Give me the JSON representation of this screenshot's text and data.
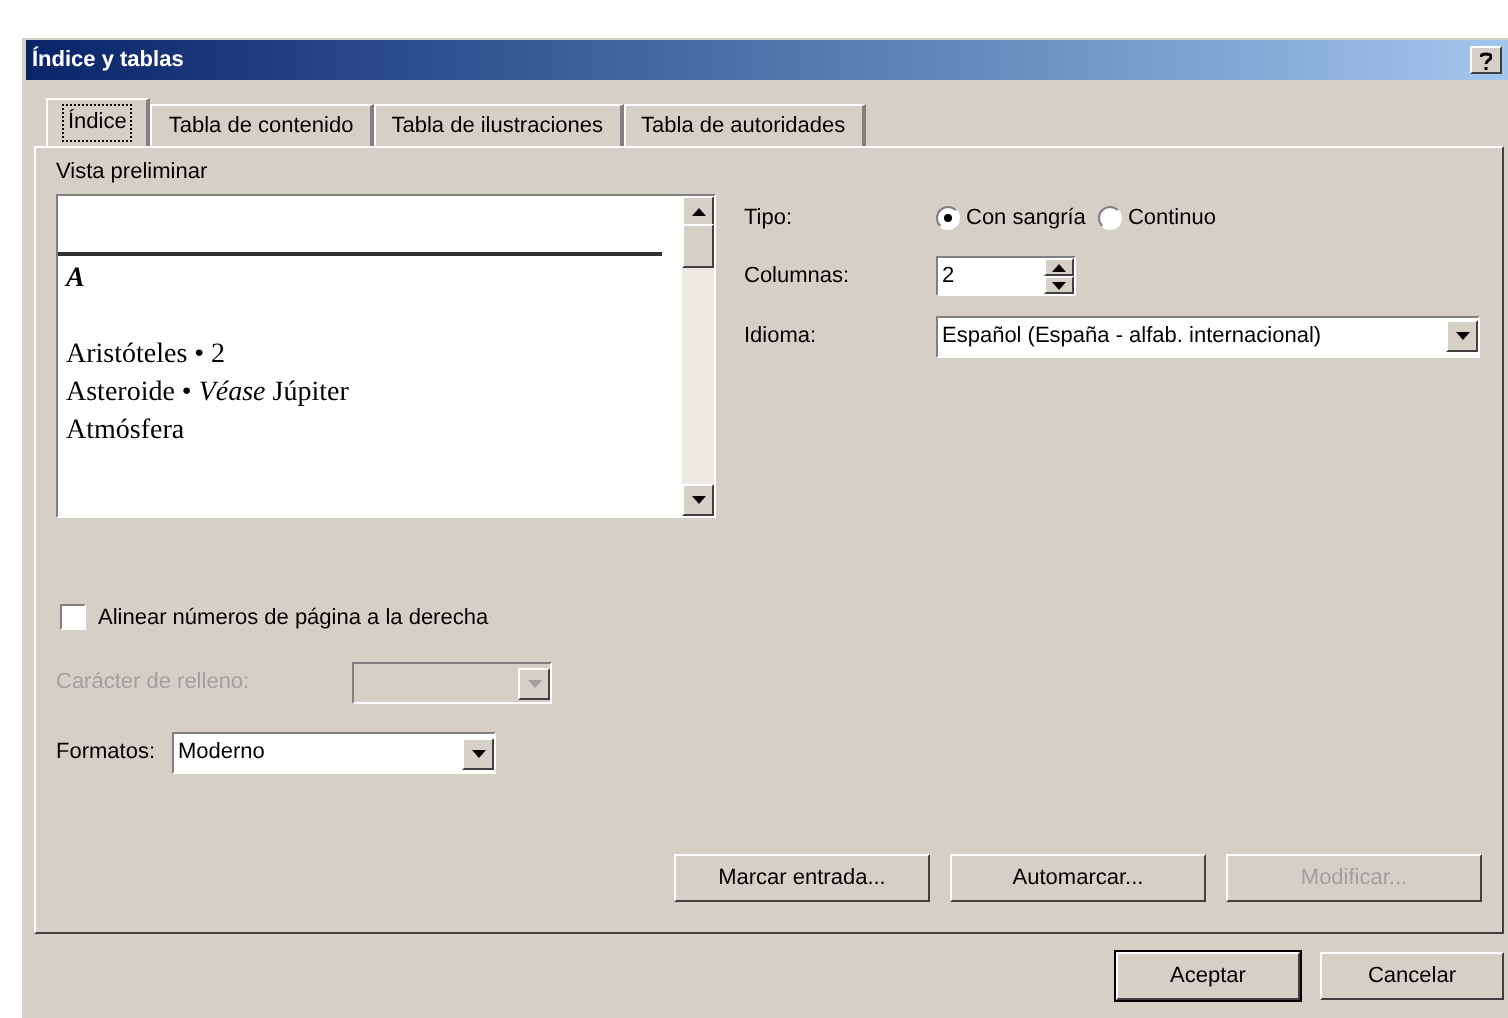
{
  "window": {
    "title": "Índice y tablas"
  },
  "tabs": [
    {
      "label": "Índice",
      "selected": true
    },
    {
      "label": "Tabla de contenido",
      "selected": false
    },
    {
      "label": "Tabla de ilustraciones",
      "selected": false
    },
    {
      "label": "Tabla de autoridades",
      "selected": false
    }
  ],
  "preview": {
    "label": "Vista preliminar",
    "entries": [
      {
        "kind": "heading",
        "text": "A"
      },
      {
        "kind": "entry",
        "text": "Aristóteles • 2"
      },
      {
        "kind": "entry",
        "text": "Asteroide • *Véase* Júpiter"
      },
      {
        "kind": "entry",
        "text": "Atmósfera"
      }
    ]
  },
  "type": {
    "label": "Tipo:",
    "options": [
      {
        "label": "Con sangría",
        "selected": true
      },
      {
        "label": "Continuo",
        "selected": false
      }
    ]
  },
  "columns": {
    "label": "Columnas:",
    "value": "2"
  },
  "language": {
    "label": "Idioma:",
    "value": "Español (España - alfab. internacional)"
  },
  "align_right": {
    "label": "Alinear números de página a la derecha",
    "checked": false
  },
  "leader": {
    "label": "Carácter de relleno:",
    "disabled": true
  },
  "formats": {
    "label": "Formatos:",
    "value": "Moderno"
  },
  "panel_buttons": [
    {
      "label": "Marcar entrada...",
      "disabled": false
    },
    {
      "label": "Automarcar...",
      "disabled": false
    },
    {
      "label": "Modificar...",
      "disabled": true
    }
  ],
  "dialog_buttons": [
    {
      "label": "Aceptar",
      "default": true
    },
    {
      "label": "Cancelar",
      "default": false
    }
  ]
}
